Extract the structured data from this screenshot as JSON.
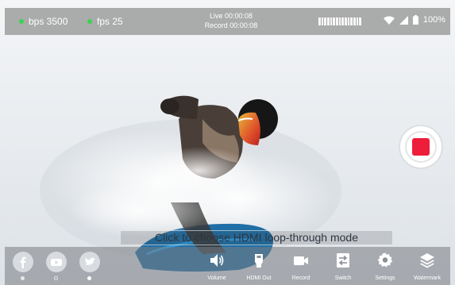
{
  "status": {
    "bps_label": "bps 3500",
    "fps_label": "fps 25",
    "live_time": "Live 00:00:08",
    "record_time": "Record 00:00:08",
    "battery_text": "100%",
    "indicator_color": "#39d353",
    "icons": [
      "audio-level-icon",
      "wifi-icon",
      "signal-icon",
      "battery-icon"
    ]
  },
  "hint": {
    "text": "Click to choose HDMI loop-through mode"
  },
  "record_button": {
    "color": "#ee1d3a"
  },
  "social": [
    {
      "name": "facebook-icon"
    },
    {
      "name": "youtube-icon"
    },
    {
      "name": "twitter-icon"
    }
  ],
  "toolbar": {
    "volume": "Volume",
    "hdmi_out": "HDMI Out",
    "record": "Record",
    "switch": "Switch",
    "settings": "Settings",
    "watermark": "Watermark"
  }
}
